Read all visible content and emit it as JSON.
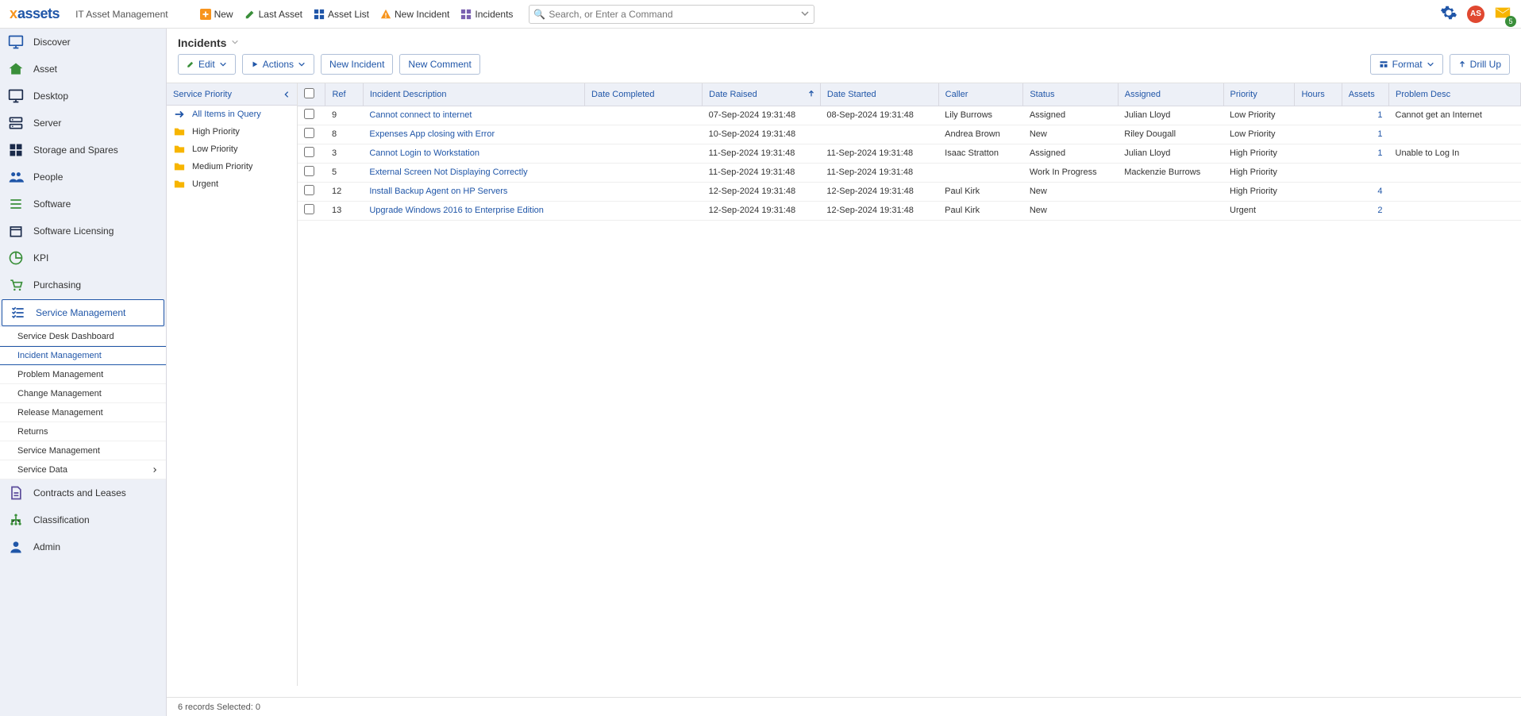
{
  "app": {
    "logo_x": "x",
    "logo_assets": "assets",
    "title": "IT Asset Management"
  },
  "top_actions": [
    {
      "label": "New",
      "icon": "plus",
      "color": "#f7941d"
    },
    {
      "label": "Last Asset",
      "icon": "pencil",
      "color": "#3a8f3a"
    },
    {
      "label": "Asset List",
      "icon": "grid",
      "color": "#2056a8"
    },
    {
      "label": "New Incident",
      "icon": "warning",
      "color": "#f7941d"
    },
    {
      "label": "Incidents",
      "icon": "grid",
      "color": "#7a5fb0"
    }
  ],
  "search": {
    "placeholder": "Search, or Enter a Command"
  },
  "top_right": {
    "avatar": "AS",
    "notif_count": "5"
  },
  "sidebar": [
    {
      "label": "Discover",
      "icon": "monitor-search"
    },
    {
      "label": "Asset",
      "icon": "house"
    },
    {
      "label": "Desktop",
      "icon": "monitor"
    },
    {
      "label": "Server",
      "icon": "server"
    },
    {
      "label": "Storage and Spares",
      "icon": "boxes"
    },
    {
      "label": "People",
      "icon": "people"
    },
    {
      "label": "Software",
      "icon": "list"
    },
    {
      "label": "Software Licensing",
      "icon": "box"
    },
    {
      "label": "KPI",
      "icon": "pie"
    },
    {
      "label": "Purchasing",
      "icon": "cart"
    },
    {
      "label": "Service Management",
      "icon": "checklist",
      "active": true,
      "sub": [
        {
          "label": "Service Desk Dashboard"
        },
        {
          "label": "Incident Management",
          "active": true
        },
        {
          "label": "Problem Management"
        },
        {
          "label": "Change Management"
        },
        {
          "label": "Release Management"
        },
        {
          "label": "Returns"
        },
        {
          "label": "Service Management"
        },
        {
          "label": "Service Data",
          "arrow": true
        }
      ]
    },
    {
      "label": "Contracts and Leases",
      "icon": "doc"
    },
    {
      "label": "Classification",
      "icon": "org"
    },
    {
      "label": "Admin",
      "icon": "user"
    }
  ],
  "page": {
    "title": "Incidents",
    "buttons": {
      "edit": "Edit",
      "actions": "Actions",
      "new_incident": "New Incident",
      "new_comment": "New Comment",
      "format": "Format",
      "drill_up": "Drill Up"
    }
  },
  "filter": {
    "header": "Service Priority",
    "items": [
      {
        "label": "All Items in Query",
        "icon": "arrow",
        "active": true
      },
      {
        "label": "High Priority",
        "icon": "folder"
      },
      {
        "label": "Low Priority",
        "icon": "folder"
      },
      {
        "label": "Medium Priority",
        "icon": "folder"
      },
      {
        "label": "Urgent",
        "icon": "folder"
      }
    ]
  },
  "table": {
    "columns": [
      "",
      "Ref",
      "Incident Description",
      "Date Completed",
      "Date Raised",
      "Date Started",
      "Caller",
      "Status",
      "Assigned",
      "Priority",
      "Hours",
      "Assets",
      "Problem Desc"
    ],
    "sorted_col": 4,
    "rows": [
      {
        "ref": "9",
        "desc": "Cannot connect to internet",
        "completed": "",
        "raised": "07-Sep-2024 19:31:48",
        "started": "08-Sep-2024 19:31:48",
        "caller": "Lily Burrows",
        "status": "Assigned",
        "assigned": "Julian Lloyd",
        "priority": "Low Priority",
        "hours": "",
        "assets": "1",
        "problem": "Cannot get an Internet"
      },
      {
        "ref": "8",
        "desc": "Expenses App closing with Error",
        "completed": "",
        "raised": "10-Sep-2024 19:31:48",
        "started": "",
        "caller": "Andrea Brown",
        "status": "New",
        "assigned": "Riley Dougall",
        "priority": "Low Priority",
        "hours": "",
        "assets": "1",
        "problem": ""
      },
      {
        "ref": "3",
        "desc": "Cannot Login to Workstation",
        "completed": "",
        "raised": "11-Sep-2024 19:31:48",
        "started": "11-Sep-2024 19:31:48",
        "caller": "Isaac Stratton",
        "status": "Assigned",
        "assigned": "Julian Lloyd",
        "priority": "High Priority",
        "hours": "",
        "assets": "1",
        "problem": "Unable to Log In"
      },
      {
        "ref": "5",
        "desc": "External Screen Not Displaying Correctly",
        "completed": "",
        "raised": "11-Sep-2024 19:31:48",
        "started": "11-Sep-2024 19:31:48",
        "caller": "",
        "status": "Work In Progress",
        "assigned": "Mackenzie Burrows",
        "priority": "High Priority",
        "hours": "",
        "assets": "",
        "problem": ""
      },
      {
        "ref": "12",
        "desc": "Install Backup Agent on HP Servers",
        "completed": "",
        "raised": "12-Sep-2024 19:31:48",
        "started": "12-Sep-2024 19:31:48",
        "caller": "Paul Kirk",
        "status": "New",
        "assigned": "",
        "priority": "High Priority",
        "hours": "",
        "assets": "4",
        "problem": ""
      },
      {
        "ref": "13",
        "desc": "Upgrade Windows 2016 to Enterprise Edition",
        "completed": "",
        "raised": "12-Sep-2024 19:31:48",
        "started": "12-Sep-2024 19:31:48",
        "caller": "Paul Kirk",
        "status": "New",
        "assigned": "",
        "priority": "Urgent",
        "hours": "",
        "assets": "2",
        "problem": ""
      }
    ]
  },
  "footer": {
    "status": "6 records Selected: 0"
  }
}
